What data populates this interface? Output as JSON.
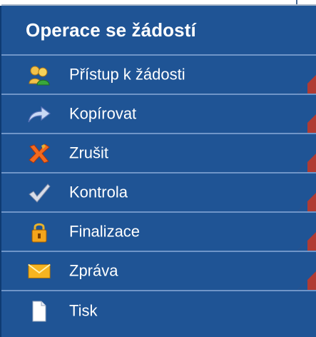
{
  "panel": {
    "title": "Operace se žádostí",
    "items": [
      {
        "label": "Přístup k žádosti",
        "icon": "users-icon"
      },
      {
        "label": "Kopírovat",
        "icon": "arrow-forward-icon"
      },
      {
        "label": "Zrušit",
        "icon": "cross-icon"
      },
      {
        "label": "Kontrola",
        "icon": "check-icon"
      },
      {
        "label": "Finalizace",
        "icon": "lock-icon"
      },
      {
        "label": "Zpráva",
        "icon": "envelope-icon"
      },
      {
        "label": "Tisk",
        "icon": "document-icon"
      }
    ]
  },
  "colors": {
    "panel_bg": "#1f5495",
    "divider": "#6f95c8",
    "corner_accent": "#b03b33",
    "text": "#ffffff"
  }
}
